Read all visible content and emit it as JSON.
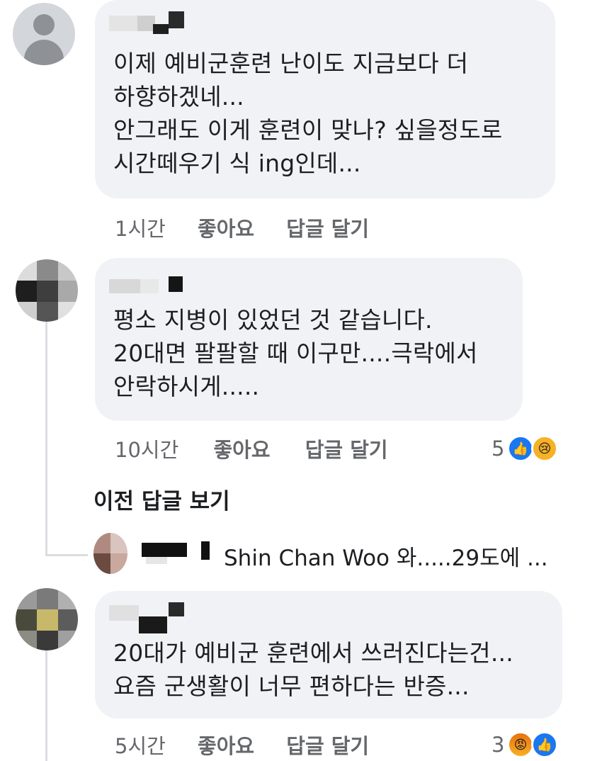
{
  "comments": [
    {
      "text": "이제 예비군훈련 난이도 지금보다 더\n하향하겠네...\n안그래도 이게 훈련이 맞나? 싶을정도로\n시간떼우기 식 ing인데...",
      "time": "1시간",
      "like_label": "좋아요",
      "reply_label": "답글 달기"
    },
    {
      "text": "평소 지병이 있었던 것 같습니다.\n20대면 팔팔할 때 이구만....극락에서\n안락하시게.....",
      "time": "10시간",
      "like_label": "좋아요",
      "reply_label": "답글 달기",
      "reaction_count": "5",
      "reactions": [
        "like-icon",
        "sad-icon"
      ]
    },
    {
      "text": "20대가 예비군 훈련에서 쓰러진다는건...\n요즘 군생활이 너무 편하다는 반증...",
      "time": "5시간",
      "like_label": "좋아요",
      "reply_label": "답글 달기",
      "reaction_count": "3",
      "reactions": [
        "angry-icon",
        "like-icon"
      ]
    }
  ],
  "thread": {
    "view_previous": "이전 답글 보기",
    "reply_preview": "Shin Chan Woo 와.....29도에 ..."
  },
  "colors": {
    "bubble": "#f0f2f5",
    "meta_text": "#65676b",
    "like_blue": "#1877f2"
  }
}
